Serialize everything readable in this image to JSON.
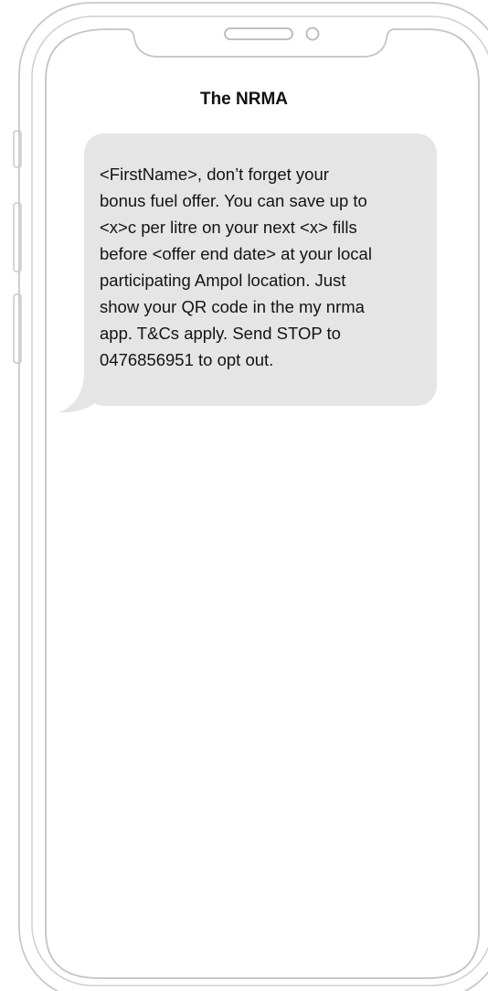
{
  "header": {
    "sender_name": "The NRMA"
  },
  "message": {
    "text": "<FirstName>, don’t forget your\nbonus fuel offer. You can save up to\n<x>c per litre on your next <x> fills\nbefore <offer end date> at your local\nparticipating Ampol location. Just\nshow your QR code in the my nrma\napp. T&Cs apply. Send STOP to\n0476856951 to opt out."
  },
  "colors": {
    "bubble_background": "#e5e5e6",
    "phone_outline": "#c8c8c8"
  }
}
